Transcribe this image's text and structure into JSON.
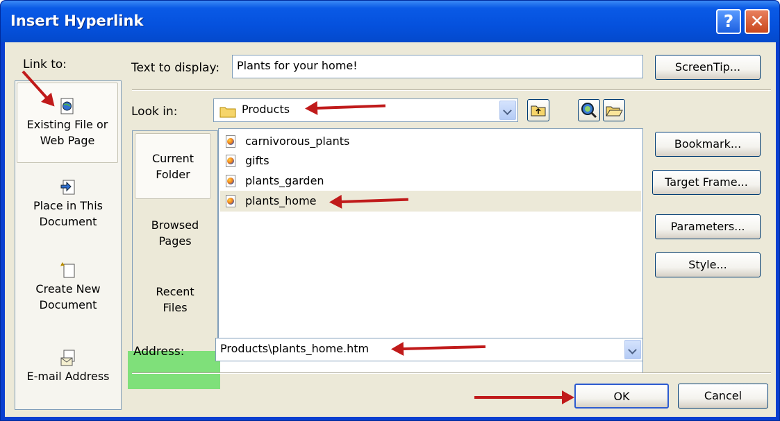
{
  "dialog": {
    "title": "Insert Hyperlink",
    "help_label": "?",
    "close_label": "✕"
  },
  "link_to": {
    "label": "Link to:",
    "items": [
      {
        "line1": "Existing File or",
        "line2": "Web Page",
        "icon": "web-page-icon",
        "selected": true
      },
      {
        "line1": "Place in This",
        "line2": "Document",
        "icon": "place-in-document-icon",
        "selected": false
      },
      {
        "line1": "Create New",
        "line2": "Document",
        "icon": "new-document-icon",
        "selected": false
      },
      {
        "line1": "E-mail Address",
        "line2": "",
        "icon": "email-address-icon",
        "selected": false
      }
    ]
  },
  "text_to_display": {
    "label": "Text to display:",
    "value": "Plants for your home!"
  },
  "look_in": {
    "label": "Look in:",
    "value": "Products",
    "icon": "folder-icon"
  },
  "places": [
    {
      "line1": "Current",
      "line2": "Folder",
      "selected": true
    },
    {
      "line1": "Browsed",
      "line2": "Pages",
      "selected": false
    },
    {
      "line1": "Recent",
      "line2": "Files",
      "selected": false
    }
  ],
  "files": [
    {
      "name": "carnivorous_plants",
      "selected": false
    },
    {
      "name": "gifts",
      "selected": false
    },
    {
      "name": "plants_garden",
      "selected": false
    },
    {
      "name": "plants_home",
      "selected": true
    }
  ],
  "address": {
    "label": "Address:",
    "value": "Products\\plants_home.htm"
  },
  "buttons": {
    "screentip": "ScreenTip...",
    "bookmark": "Bookmark...",
    "target_frame": "Target Frame...",
    "parameters": "Parameters...",
    "style": "Style...",
    "ok": "OK",
    "cancel": "Cancel"
  },
  "colors": {
    "title_blue": "#0551dd",
    "address_highlight": "#7fe07a",
    "annotation_arrow": "#c01a1a"
  }
}
